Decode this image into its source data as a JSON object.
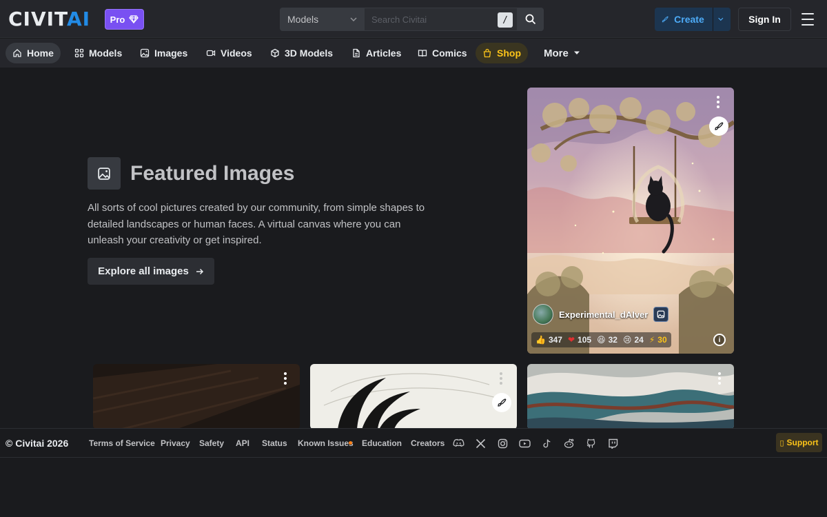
{
  "header": {
    "logo_part1": "CIVIT",
    "logo_part2": "AI",
    "pro_label": "Pro",
    "search_category": "Models",
    "search_placeholder": "Search Civitai",
    "search_shortcut": "/",
    "create_label": "Create",
    "signin_label": "Sign In"
  },
  "nav": {
    "items": [
      {
        "label": "Home",
        "icon": "home-icon",
        "active": true
      },
      {
        "label": "Models",
        "icon": "grid-icon"
      },
      {
        "label": "Images",
        "icon": "photo-icon"
      },
      {
        "label": "Videos",
        "icon": "video-icon"
      },
      {
        "label": "3D Models",
        "icon": "cube-icon"
      },
      {
        "label": "Articles",
        "icon": "file-text-icon"
      },
      {
        "label": "Comics",
        "icon": "book-icon"
      },
      {
        "label": "Shop",
        "icon": "shopping-bag-icon"
      }
    ],
    "more_label": "More"
  },
  "featured": {
    "title": "Featured Images",
    "description": "All sorts of cool pictures created by our community, from simple shapes to detailed landscapes or human faces. A virtual canvas where you can unleash your creativity or get inspired.",
    "explore_label": "Explore all images"
  },
  "main_card": {
    "creator": "Experimental_dAIver",
    "reactions": {
      "likes": "347",
      "hearts": "105",
      "laughs": "32",
      "cries": "24",
      "buzz": "30"
    }
  },
  "footer": {
    "copyright": "© Civitai 2026",
    "links": [
      "Terms of Service",
      "Privacy",
      "Safety",
      "API",
      "Status",
      "Known Issues",
      "Education",
      "Creators"
    ],
    "support_label": "Support"
  },
  "colors": {
    "accent": "#228be6",
    "pro": "#7950f2",
    "shop": "#fcc419",
    "background": "#1a1b1e",
    "surface": "#25262b"
  }
}
